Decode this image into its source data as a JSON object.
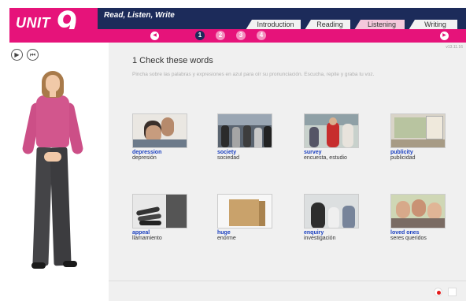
{
  "header": {
    "unit_word": "UNIT",
    "unit_number": "9",
    "section_title": "Read, Listen, Write",
    "tabs": [
      {
        "label": "Introduction",
        "active": false
      },
      {
        "label": "Reading",
        "active": false
      },
      {
        "label": "Listening",
        "active": true
      },
      {
        "label": "Writing",
        "active": false
      }
    ],
    "pages": [
      "1",
      "2",
      "3",
      "4"
    ],
    "current_page": "1",
    "colors": {
      "navy": "#1c2b5a",
      "pink": "#e6137a",
      "link": "#1a3fbf"
    }
  },
  "player": {
    "play_icon": "play-icon",
    "restart_icon": "rewind-icon"
  },
  "main": {
    "version": "v13.11.16",
    "heading": "1  Check these words",
    "instruction": "Pincha sobre las palabras y expresiones en azul para oír su pronunciación. Escucha, repite y graba tu voz.",
    "words": [
      {
        "word": "depression",
        "translation": "depresión"
      },
      {
        "word": "society",
        "translation": "sociedad"
      },
      {
        "word": "survey",
        "translation": "encuesta, estudio"
      },
      {
        "word": "publicity",
        "translation": "publicidad"
      },
      {
        "word": "appeal",
        "translation": "llamamiento"
      },
      {
        "word": "huge",
        "translation": "enorme"
      },
      {
        "word": "enquiry",
        "translation": "investigación"
      },
      {
        "word": "loved ones",
        "translation": "seres queridos"
      }
    ]
  },
  "footer": {
    "record_icon": "record-icon",
    "play_icon": "play-recording-icon"
  }
}
